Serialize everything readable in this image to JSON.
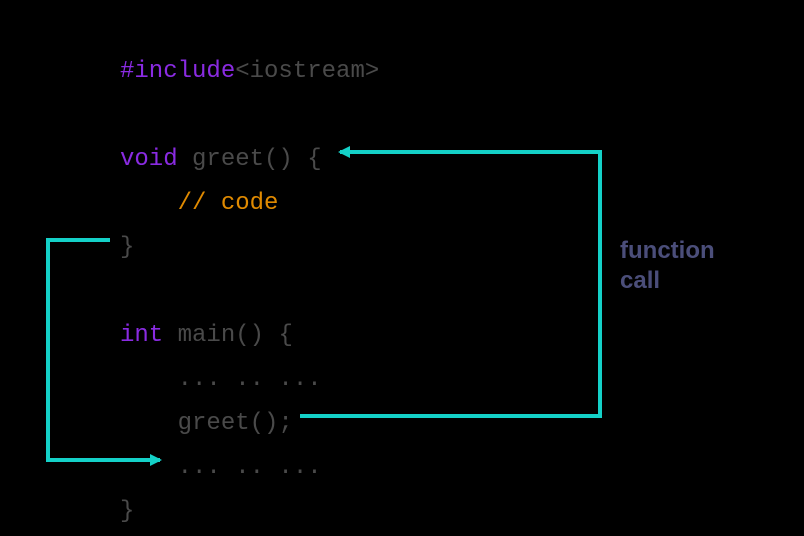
{
  "code": {
    "preproc_directive": "#include",
    "preproc_header": "<iostream>",
    "kw_void": "void",
    "func_greet_decl": " greet() {",
    "indent": "    ",
    "comment_code": "// code",
    "close_brace": "}",
    "kw_int": "int",
    "func_main_decl": " main() {",
    "ellipsis": "... .. ...",
    "call_greet": "greet();"
  },
  "annotations": {
    "function_call": "function\ncall"
  },
  "colors": {
    "arrow": "#14d1c8",
    "keyword": "#8a2be2",
    "comment": "#e08a00",
    "default": "#4a4a4a",
    "annotation": "#4b4e7a",
    "background": "#000000"
  }
}
